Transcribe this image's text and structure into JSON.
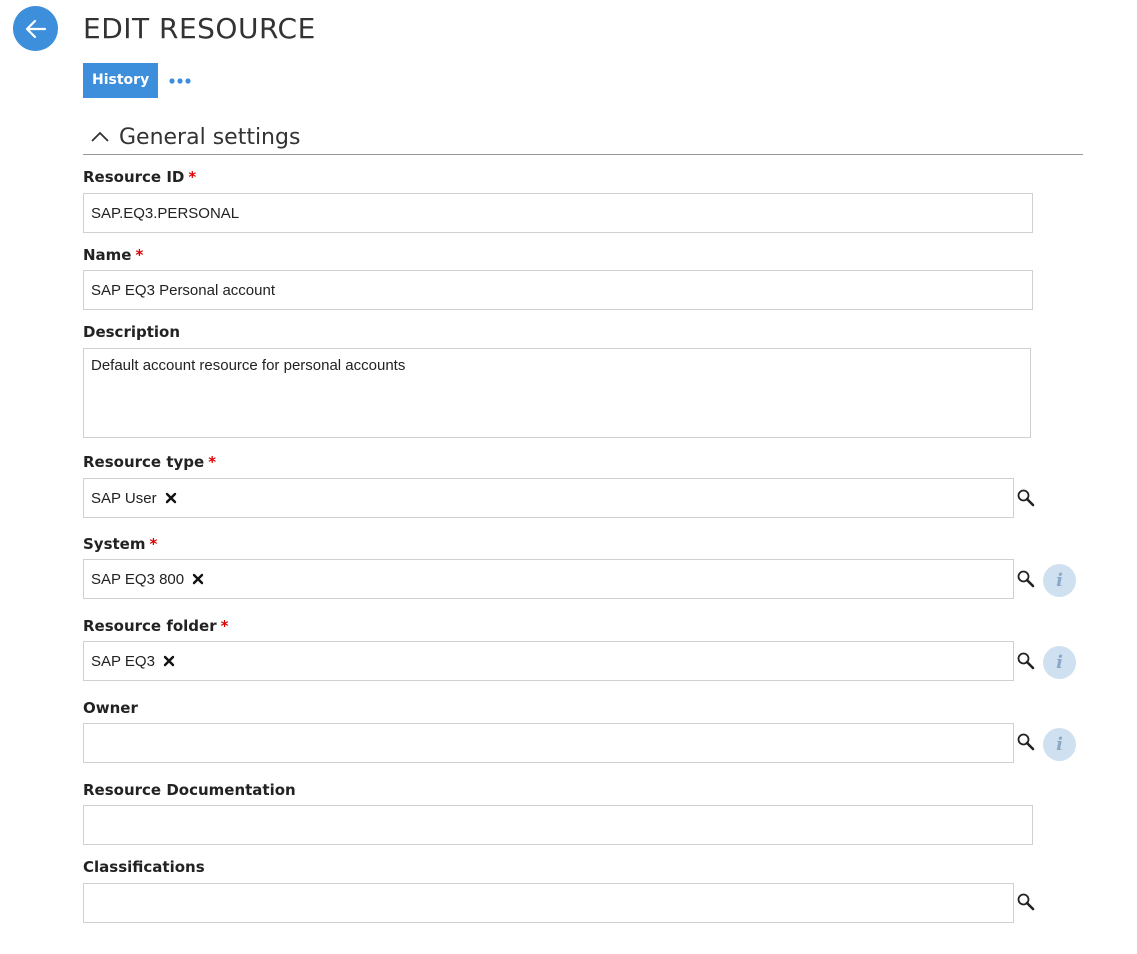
{
  "header": {
    "title": "EDIT RESOURCE",
    "history_label": "History",
    "back_icon": "arrow-left-icon",
    "more_icon": "more-dots-icon"
  },
  "section": {
    "title": "General settings"
  },
  "fields": {
    "resource_id": {
      "label": "Resource ID",
      "required_mark": "*",
      "value": "SAP.EQ3.PERSONAL"
    },
    "name": {
      "label": "Name",
      "required_mark": "*",
      "value": "SAP EQ3 Personal account"
    },
    "description": {
      "label": "Description",
      "value": "Default account resource for personal accounts"
    },
    "resource_type": {
      "label": "Resource type",
      "required_mark": "*",
      "tag": "SAP User"
    },
    "system": {
      "label": "System",
      "required_mark": "*",
      "tag": "SAP EQ3 800"
    },
    "resource_folder": {
      "label": "Resource folder",
      "required_mark": "*",
      "tag": "SAP EQ3"
    },
    "owner": {
      "label": "Owner",
      "value": ""
    },
    "resource_documentation": {
      "label": "Resource Documentation",
      "value": ""
    },
    "classifications": {
      "label": "Classifications",
      "value": ""
    }
  },
  "icons": {
    "info_glyph": "i"
  },
  "colors": {
    "accent": "#3d8fdc",
    "required": "#dd0000",
    "info_bg": "#cfe0f0"
  }
}
